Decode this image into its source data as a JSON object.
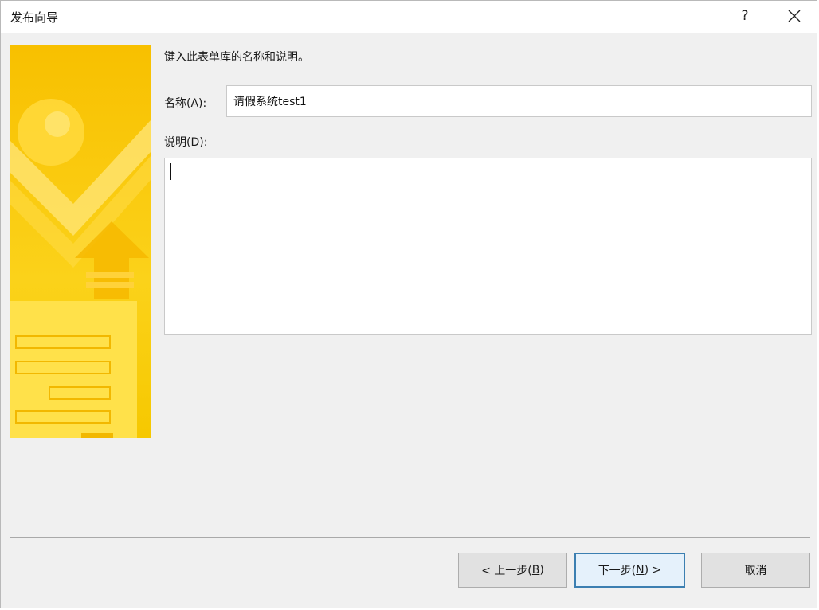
{
  "window": {
    "title": "发布向导",
    "help_label": "?"
  },
  "content": {
    "instruction": "键入此表单库的名称和说明。",
    "name_label_prefix": "名称(",
    "name_label_key": "A",
    "name_label_suffix": "):",
    "name_value": "请假系统test1",
    "description_label_prefix": "说明(",
    "description_label_key": "D",
    "description_label_suffix": "):",
    "description_value": ""
  },
  "buttons": {
    "back_prefix": "< 上一步(",
    "back_key": "B",
    "back_suffix": ")",
    "next_prefix": "下一步(",
    "next_key": "N",
    "next_suffix": ") >",
    "cancel": "取消"
  },
  "colors": {
    "banner_yellow": "#f8c400",
    "banner_light": "#ffe55a",
    "primary_button_border": "#3c7fb1"
  },
  "icons": [
    "help-icon",
    "close-icon",
    "wizard-banner-image"
  ]
}
